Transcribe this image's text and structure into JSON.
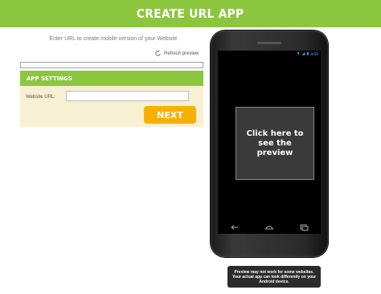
{
  "banner": {
    "title": "CREATE URL APP"
  },
  "intro": {
    "instructions": "Enter URL to create mobile version of your Website"
  },
  "refresh": {
    "label": "Refresh preview",
    "icon": "refresh-icon"
  },
  "settings": {
    "header": "APP SETTINGS",
    "url_label": "Website URL:",
    "url_value": "",
    "url_placeholder": "",
    "next_label": "NEXT"
  },
  "phone": {
    "status_time": "4:00",
    "preview_text": "Click here to see the preview",
    "soft_keys": [
      "back-icon",
      "home-icon",
      "recent-apps-icon"
    ]
  },
  "disclaimer": "Preview may not work for some websites. Your actual app can look differently on your Android device.",
  "colors": {
    "brand_green": "#8cc63f",
    "next_orange": "#f8b000",
    "status_blue": "#33b5e5"
  }
}
